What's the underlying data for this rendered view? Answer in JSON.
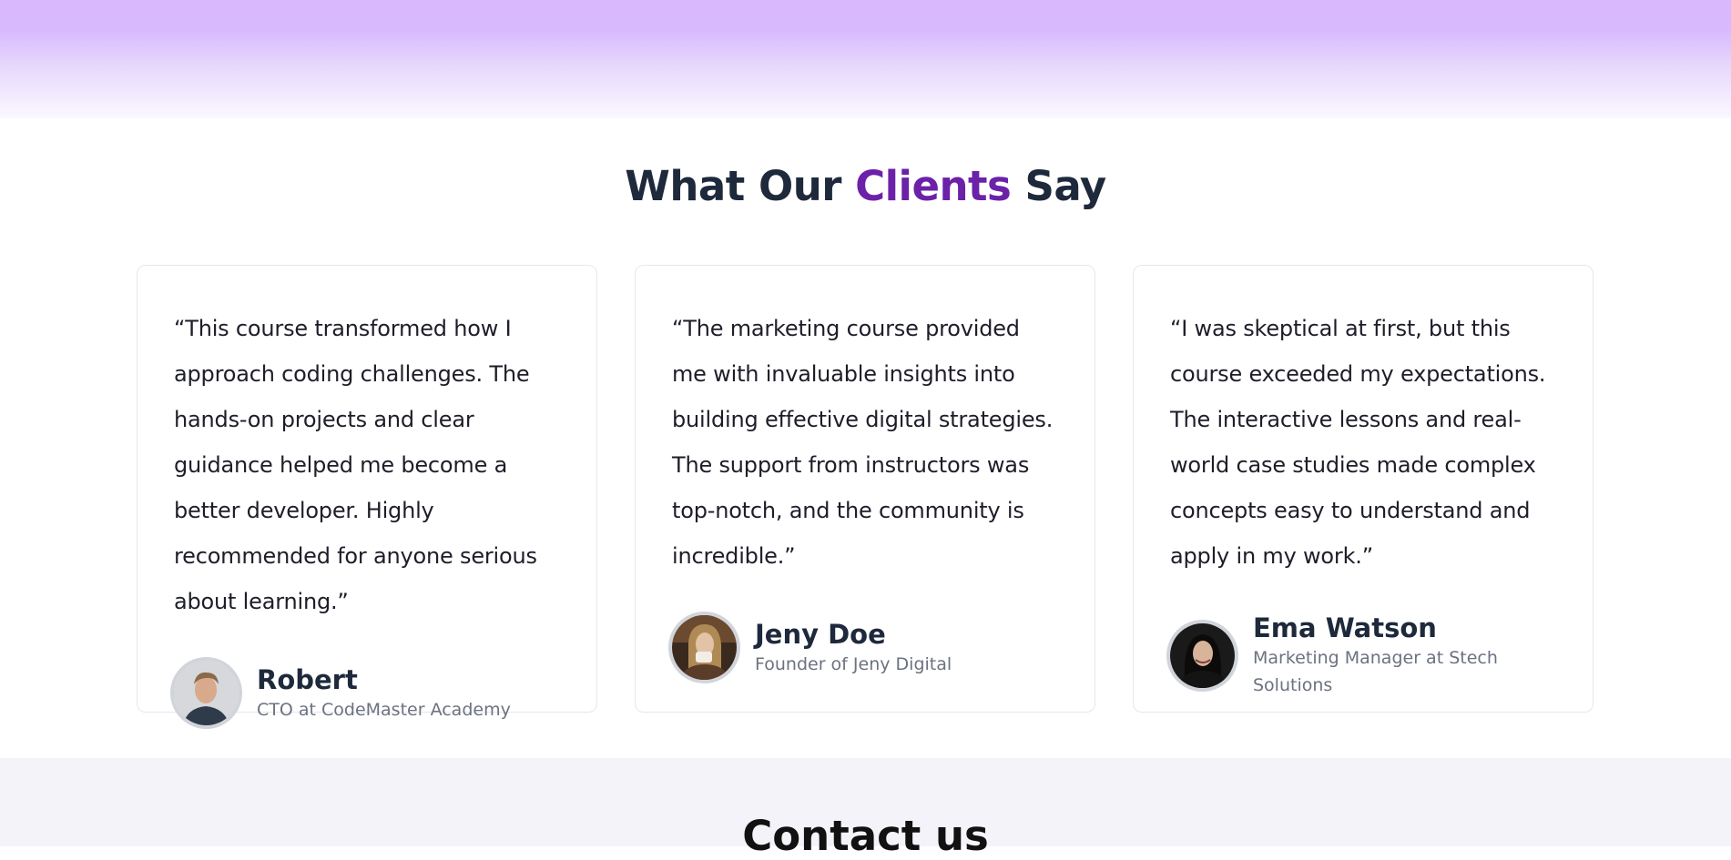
{
  "section": {
    "title_before": "What Our ",
    "title_accent": "Clients",
    "title_after": " Say",
    "accent_color": "#6b21a8"
  },
  "testimonials": [
    {
      "quote": "“This course transformed how I approach coding challenges. The hands-on projects and clear guidance helped me become a better developer. Highly recommended for anyone serious about learning.”",
      "name": "Robert",
      "role": "CTO at CodeMaster Academy"
    },
    {
      "quote": "“The marketing course provided me with invaluable insights into building effective digital strategies. The support from instructors was top-notch, and the community is incredible.”",
      "name": "Jeny Doe",
      "role": "Founder of Jeny Digital"
    },
    {
      "quote": "“I was skeptical at first, but this course exceeded my expectations. The interactive lessons and real-world case studies made complex concepts easy to understand and apply in my work.”",
      "name": "Ema Watson",
      "role": "Marketing Manager at Stech Solutions"
    }
  ],
  "contact": {
    "title": "Contact us"
  }
}
